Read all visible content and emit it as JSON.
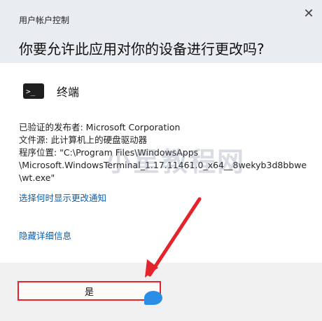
{
  "dialog": {
    "title": "用户帐户控制",
    "close_icon": "close-icon",
    "question": "你要允许此应用对你的设备进行更改吗?"
  },
  "app": {
    "icon": "terminal-icon",
    "icon_glyph": ">_",
    "name": "终端"
  },
  "details": {
    "publisher": "已验证的发布者: Microsoft Corporation",
    "source": "文件源: 此计算机上的硬盘驱动器",
    "location_line1": "程序位置: \"C:\\Program Files\\WindowsApps",
    "location_line2": "\\Microsoft.WindowsTerminal_1.17.11461.0_x64__8wekyb3d8bbwe",
    "location_line3": "\\wt.exe\""
  },
  "links": {
    "show_notifications": "选择何时显示更改通知",
    "hide_details": "隐藏详细信息"
  },
  "buttons": {
    "yes": "是"
  },
  "watermark": "小星教程网",
  "colors": {
    "header_bg": "#e9ecf0",
    "link": "#0a5fb0",
    "highlight_red": "#e4232b",
    "footer_bg": "#f0f0f0"
  }
}
